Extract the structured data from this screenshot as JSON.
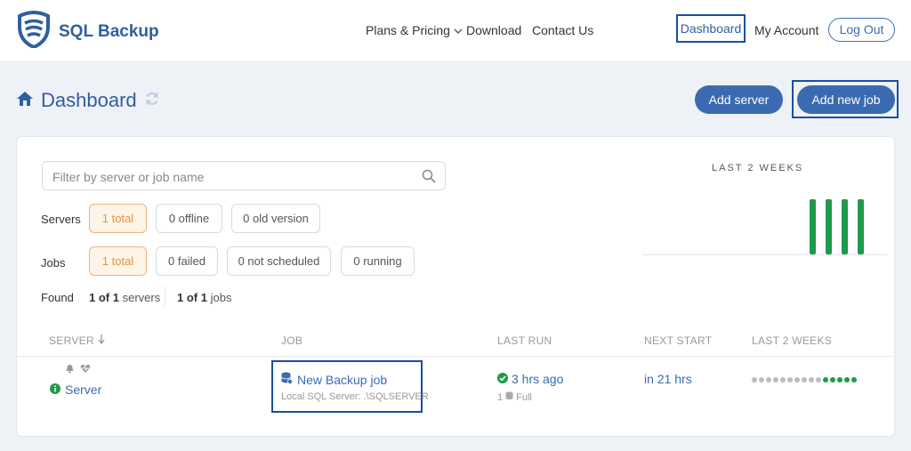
{
  "brand": {
    "name": "SQL Backup"
  },
  "nav": {
    "plans": "Plans & Pricing",
    "download": "Download",
    "contact": "Contact Us",
    "dashboard": "Dashboard",
    "account": "My Account",
    "logout": "Log Out"
  },
  "page": {
    "title": "Dashboard",
    "add_server": "Add server",
    "add_job": "Add new job"
  },
  "filters": {
    "search_placeholder": "Filter by server or job name",
    "servers_label": "Servers",
    "servers_chips": [
      "1 total",
      "0 offline",
      "0 old version"
    ],
    "jobs_label": "Jobs",
    "jobs_chips": [
      "1 total",
      "0 failed",
      "0 not scheduled",
      "0 running"
    ],
    "found_label": "Found",
    "found_servers_count": "1 of 1",
    "found_servers_word": "servers",
    "found_jobs_count": "1 of 1",
    "found_jobs_word": "jobs"
  },
  "summary_chart": {
    "title": "LAST 2 WEEKS",
    "bar_color": "#1f9a4a",
    "values": [
      0,
      0,
      0,
      0,
      0,
      0,
      0,
      0,
      0,
      0,
      1,
      1,
      1,
      1
    ]
  },
  "table": {
    "headers": {
      "server": "SERVER",
      "job": "JOB",
      "last_run": "LAST RUN",
      "next_start": "NEXT START",
      "last_2_weeks": "LAST 2 WEEKS"
    },
    "rows": [
      {
        "server": "Server",
        "job_name": "New Backup job",
        "job_sub": "Local SQL Server: .\\SQLSERVER",
        "last_run": "3 hrs ago",
        "last_run_count": "1",
        "last_run_type": "Full",
        "next_start": "in 21 hrs",
        "history": [
          0,
          0,
          0,
          0,
          0,
          0,
          0,
          0,
          0,
          0,
          1,
          1,
          1,
          1,
          1
        ]
      }
    ]
  },
  "colors": {
    "brand": "#2f5f9e",
    "accent": "#3a6bb0",
    "success": "#1f9a4a",
    "highlight": "#1a4fa0",
    "active_chip": "#e8913a"
  }
}
